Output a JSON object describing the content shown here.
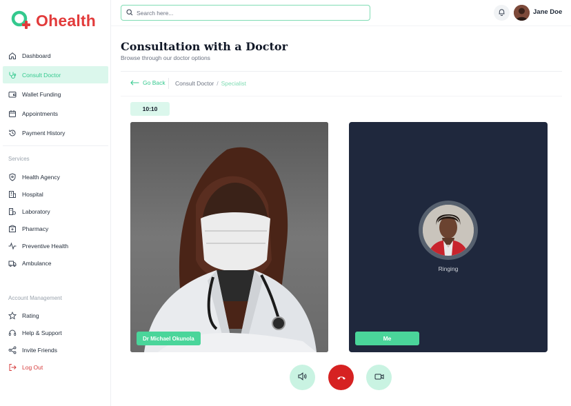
{
  "brand": {
    "name": "Ohealth",
    "accent": "#34c98e",
    "brand_red": "#e23b3b"
  },
  "sidebar": {
    "main_items": [
      {
        "label": "Dashboard",
        "icon": "home-icon"
      },
      {
        "label": "Consult Doctor",
        "icon": "stethoscope-icon",
        "active": true
      },
      {
        "label": "Wallet Funding",
        "icon": "wallet-icon"
      },
      {
        "label": "Appointments",
        "icon": "calendar-icon"
      },
      {
        "label": "Payment History",
        "icon": "history-icon"
      }
    ],
    "services_label": "Services",
    "services_items": [
      {
        "label": "Health Agency",
        "icon": "shield-icon"
      },
      {
        "label": "Hospital",
        "icon": "hospital-icon"
      },
      {
        "label": "Laboratory",
        "icon": "flask-icon"
      },
      {
        "label": "Pharmacy",
        "icon": "pharmacy-icon"
      },
      {
        "label": "Preventive Health",
        "icon": "pulse-icon"
      },
      {
        "label": "Ambulance",
        "icon": "ambulance-icon"
      }
    ],
    "account_label": "Account Management",
    "account_items": [
      {
        "label": "Rating",
        "icon": "star-icon"
      },
      {
        "label": "Help & Support",
        "icon": "headset-icon"
      },
      {
        "label": "Invite Friends",
        "icon": "share-icon"
      },
      {
        "label": "Log Out",
        "icon": "logout-icon"
      }
    ]
  },
  "topbar": {
    "search_placeholder": "Search here...",
    "user_name": "Jane Doe"
  },
  "main": {
    "title": "Consultation with a Doctor",
    "subtitle": "Browse through our doctor options",
    "go_back": "Go Back",
    "breadcrumb": [
      "Consult Doctor",
      "Specialist"
    ],
    "timer": "10:10",
    "doctor_name": "Dr Michael Okunola",
    "call_status": "Ringing",
    "self_label": "Me"
  }
}
